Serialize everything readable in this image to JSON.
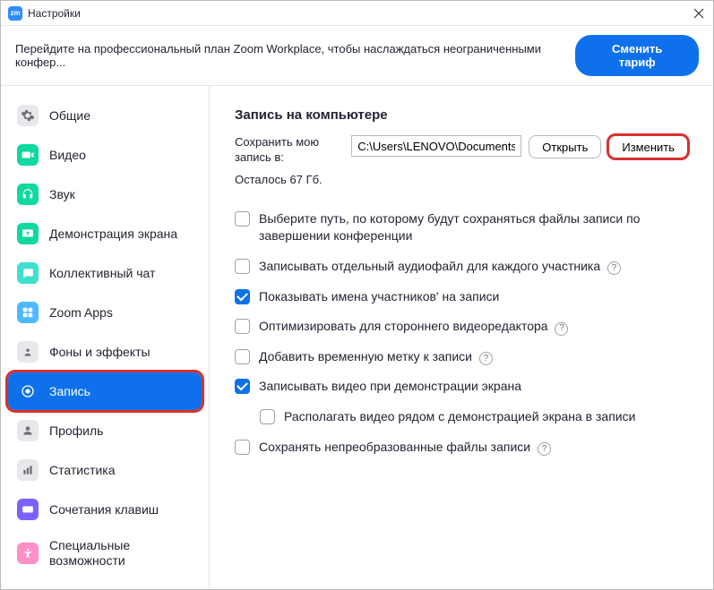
{
  "titlebar": {
    "title": "Настройки"
  },
  "banner": {
    "text": "Перейдите на профессиональный план Zoom Workplace, чтобы наслаждаться неограниченными конфер...",
    "button": "Сменить тариф"
  },
  "sidebar": {
    "items": [
      {
        "label": "Общие"
      },
      {
        "label": "Видео"
      },
      {
        "label": "Звук"
      },
      {
        "label": "Демонстрация экрана"
      },
      {
        "label": "Коллективный чат"
      },
      {
        "label": "Zoom Apps"
      },
      {
        "label": "Фоны и эффекты"
      },
      {
        "label": "Запись"
      },
      {
        "label": "Профиль"
      },
      {
        "label": "Статистика"
      },
      {
        "label": "Сочетания клавиш"
      },
      {
        "label": "Специальные возможности"
      }
    ]
  },
  "main": {
    "section_title": "Запись на компьютере",
    "path_label": "Сохранить мою запись в:",
    "path_value": "C:\\Users\\LENOVO\\Documents\\Z",
    "open_btn": "Открыть",
    "change_btn": "Изменить",
    "remaining": "Осталось 67 Гб.",
    "options": [
      {
        "label": "Выберите путь, по которому будут сохраняться файлы записи по завершении конференции",
        "checked": false,
        "help": false
      },
      {
        "label": "Записывать отдельный аудиофайл для каждого участника",
        "checked": false,
        "help": true
      },
      {
        "label": "Показывать имена участников' на записи",
        "checked": true,
        "help": false
      },
      {
        "label": "Оптимизировать для стороннего видеоредактора",
        "checked": false,
        "help": true
      },
      {
        "label": "Добавить временную метку к записи",
        "checked": false,
        "help": true
      },
      {
        "label": "Записывать видео при демонстрации экрана",
        "checked": true,
        "help": false
      },
      {
        "label": "Располагать видео рядом с демонстрацией экрана в записи",
        "checked": false,
        "help": false,
        "indented": true
      },
      {
        "label": "Сохранять непреобразованные файлы записи",
        "checked": false,
        "help": true
      }
    ]
  }
}
